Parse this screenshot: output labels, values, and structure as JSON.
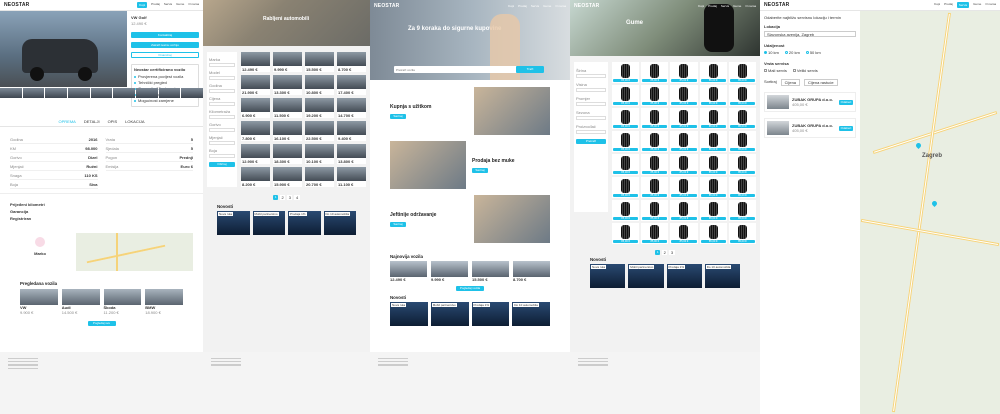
{
  "brand": {
    "logo": "NEOSTAR",
    "accent": "#1ec1e8",
    "save_label": "Spremi"
  },
  "nav": {
    "items": [
      "Kupi",
      "Prodaj",
      "Servis",
      "Gume",
      "O nama"
    ]
  },
  "p1": {
    "car_title": "VW Golf",
    "price": "12.490 €",
    "btn_primary": "Kontaktiraj",
    "btn_secondary": "Zatraži testnu vožnju",
    "btn_third": "Financiraj",
    "check_title": "Neostar certificirano vozilo",
    "checks": [
      "Provjerena povijest vozila",
      "Tehnički pregled",
      "Garancija 12 mjeseci",
      "Servisna knjižica",
      "Mogućnost zamjene"
    ],
    "tabs": [
      "OPREMA",
      "DETALJI",
      "OPIS",
      "LOKACIJA"
    ],
    "specs_left": [
      [
        "Godina",
        "2016"
      ],
      [
        "KM",
        "98.000"
      ],
      [
        "Gorivo",
        "Dizel"
      ],
      [
        "Mjenjač",
        "Ručni"
      ],
      [
        "Snaga",
        "110 KS"
      ],
      [
        "Boja",
        "Siva"
      ]
    ],
    "specs_right": [
      [
        "Vrata",
        "5"
      ],
      [
        "Sjedala",
        "5"
      ],
      [
        "Pogon",
        "Prednji"
      ],
      [
        "Emisija",
        "Euro 6"
      ]
    ],
    "info": [
      "Prijeđeni kilometri",
      "Garancija",
      "Registriran"
    ],
    "contact_name": "Marko",
    "recent_title": "Pregledana vozila",
    "recent_cars": [
      {
        "name": "VW",
        "price": "9.900 €"
      },
      {
        "name": "Audi",
        "price": "14.500 €"
      },
      {
        "name": "Škoda",
        "price": "11.200 €"
      },
      {
        "name": "BMW",
        "price": "18.900 €"
      }
    ],
    "recent_button": "Pogledaj sve"
  },
  "p2": {
    "hero_title": "Rabljeni automobili",
    "filters": [
      "Marka",
      "Model",
      "Godina",
      "Cijena",
      "Kilometraža",
      "Gorivo",
      "Mjenjač",
      "Boja"
    ],
    "filter_button": "Filtriraj",
    "listing_prices": [
      "12.490 €",
      "9.990 €",
      "15.500 €",
      "8.700 €",
      "21.900 €",
      "13.300 €",
      "10.800 €",
      "17.400 €",
      "6.900 €",
      "11.500 €",
      "19.200 €",
      "14.700 €",
      "7.800 €",
      "16.100 €",
      "22.500 €",
      "9.400 €",
      "12.900 €",
      "18.300 €",
      "10.100 €",
      "13.800 €",
      "8.200 €",
      "15.900 €",
      "20.700 €",
      "11.100 €"
    ],
    "news_title": "Novosti",
    "news": [
      "Nova ruta",
      "Mobil partnerstvo",
      "Prodaja 1%",
      "Do 10 automobila"
    ],
    "pages": [
      "1",
      "2",
      "3",
      "4"
    ]
  },
  "p3": {
    "hero_title": "Za 9 koraka do sigurne kupovine",
    "search_placeholder": "Pretraži vozila",
    "search_button": "Traži",
    "sections": [
      {
        "title": "Kupnja s užitkom",
        "button": "Saznaj"
      },
      {
        "title": "Prodaja bez muke",
        "button": "Saznaj"
      },
      {
        "title": "Jeftinije održavanje",
        "button": "Saznaj"
      }
    ],
    "popular_title": "Najnovija vozila",
    "popular_prices": [
      "12.490 €",
      "9.990 €",
      "15.500 €",
      "8.700 €"
    ],
    "popular_button": "Pogledaj vozila",
    "news_title": "Novosti",
    "news": [
      "Nova ruta",
      "Mobil partnerstvo",
      "Prodaja 1%",
      "Do 10 automobila"
    ]
  },
  "p4": {
    "hero_title": "Gume",
    "filters": [
      "Širina",
      "Visina",
      "Promjer",
      "Sezona",
      "Proizvođač"
    ],
    "filter_button": "Pretraži",
    "tire_price": "85,00 €",
    "news_title": "Novosti",
    "news": [
      "Nova ruta",
      "Mobil partnerstvo",
      "Prodaja 1%",
      "Do 10 automobila"
    ],
    "pages": [
      "1",
      "2",
      "3"
    ]
  },
  "p5": {
    "intro": "Odaberite najbližu servisnu lokaciju i termin",
    "address_label": "Lokacija",
    "address_value": "Slavonska avenija, Zagreb",
    "distance_label": "Udaljenost",
    "distances": [
      "10 km",
      "20 km",
      "50 km"
    ],
    "type_label": "Vrsta servisa",
    "types": [
      "Mali servis",
      "Veliki servis"
    ],
    "sort_label": "Sortiraj",
    "sort_value": "Cijena",
    "price_label": "Cijena rastuće",
    "services": [
      {
        "name": "ZUBAK GRUPA d.o.o.",
        "price": "405,00 €",
        "btn": "Odaberi"
      },
      {
        "name": "ZUBAK GRUPA d.o.o.",
        "price": "405,00 €",
        "btn": "Odaberi"
      }
    ],
    "map_city": "Zagreb"
  }
}
